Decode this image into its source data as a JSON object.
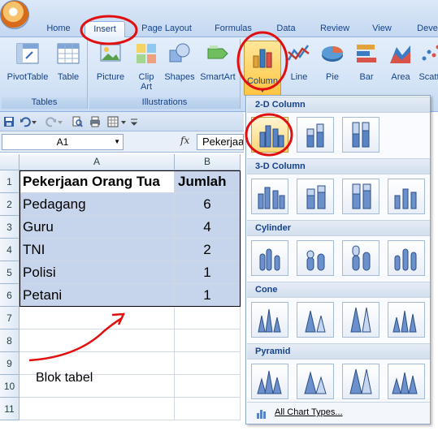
{
  "tabs": [
    "Home",
    "Insert",
    "Page Layout",
    "Formulas",
    "Data",
    "Review",
    "View",
    "Deve"
  ],
  "ribbon": {
    "tables_group": "Tables",
    "illustrations_group": "Illustrations",
    "pivottable": "PivotTable",
    "table": "Table",
    "picture": "Picture",
    "clipart_1": "Clip",
    "clipart_2": "Art",
    "shapes": "Shapes",
    "smartart": "SmartArt",
    "column": "Column",
    "line": "Line",
    "pie": "Pie",
    "bar": "Bar",
    "area": "Area",
    "scatter": "Scatt"
  },
  "formula_bar": {
    "namebox": "A1",
    "fx": "fx",
    "content": "Pekerjaa"
  },
  "columns": [
    "A",
    "B"
  ],
  "rows": [
    "1",
    "2",
    "3",
    "4",
    "5",
    "6",
    "7",
    "8",
    "9",
    "10",
    "11"
  ],
  "table": {
    "header": [
      "Pekerjaan Orang Tua",
      "Jumlah"
    ],
    "rows": [
      [
        "Pedagang",
        "6"
      ],
      [
        "Guru",
        "4"
      ],
      [
        "TNI",
        "2"
      ],
      [
        "Polisi",
        "1"
      ],
      [
        "Petani",
        "1"
      ]
    ]
  },
  "dropdown": {
    "sections": [
      "2-D Column",
      "3-D Column",
      "Cylinder",
      "Cone",
      "Pyramid"
    ],
    "footer": "All Chart Types..."
  },
  "annotation": {
    "text": "Blok tabel",
    "highlight_color": "#e01010"
  }
}
